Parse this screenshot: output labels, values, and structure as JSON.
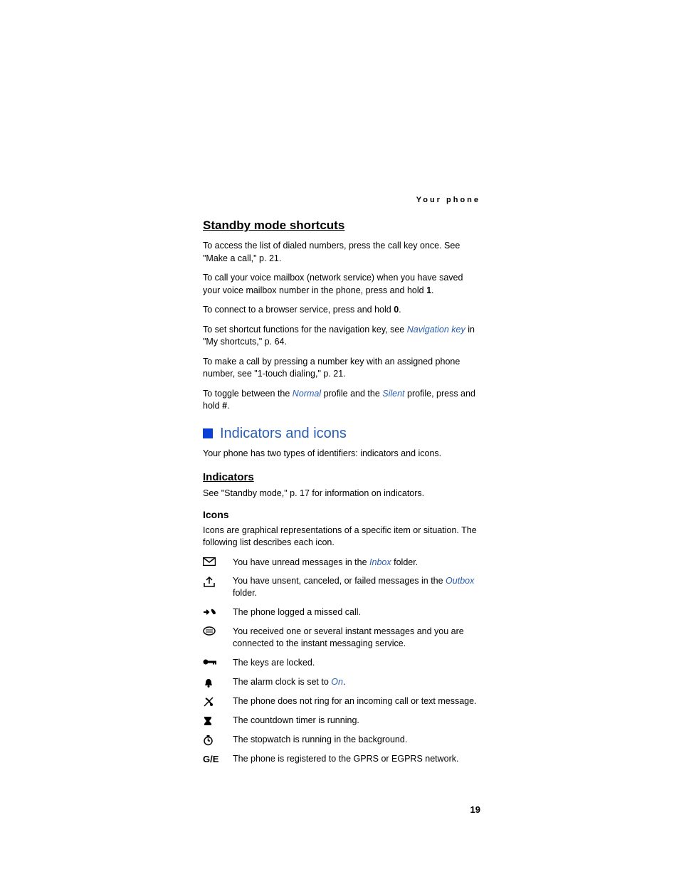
{
  "header": "Your phone",
  "heading1": "Standby mode shortcuts",
  "p1": "To access the list of dialed numbers, press the call key once. See \"Make a call,\" p. 21.",
  "p2a": "To call your voice mailbox (network service) when you have saved your voice mailbox number in the phone, press and hold ",
  "p2b": "1",
  "p2c": ".",
  "p3a": "To connect to a browser service, press and hold ",
  "p3b": "0",
  "p3c": ".",
  "p4a": "To set shortcut functions for the navigation key, see ",
  "p4link": "Navigation key",
  "p4b": " in \"My shortcuts,\" p. 64.",
  "p5": "To make a call by pressing a number key with an assigned phone number, see \"1-touch dialing,\" p. 21.",
  "p6a": "To toggle between the ",
  "p6link1": "Normal",
  "p6b": " profile and the ",
  "p6link2": "Silent",
  "p6c": " profile, press and hold ",
  "p6d": "#",
  "p6e": ".",
  "section_title": "Indicators and icons",
  "intro": "Your phone has two types of identifiers: indicators and icons.",
  "h_indicators": "Indicators",
  "p_indicators": "See \"Standby mode,\" p. 17 for information on indicators.",
  "h_icons": "Icons",
  "p_icons": "Icons are graphical representations of a specific item or situation. The following list describes each icon.",
  "icons": [
    {
      "desc_pre": "You have unread messages in the ",
      "link": "Inbox",
      "desc_post": " folder."
    },
    {
      "desc_pre": "You have unsent, canceled, or failed messages in the ",
      "link": "Outbox",
      "desc_post": " folder."
    },
    {
      "desc": "The phone logged a missed call."
    },
    {
      "desc": "You received one or several instant messages and you are connected to the instant messaging service."
    },
    {
      "desc": "The keys are locked."
    },
    {
      "desc_pre": "The alarm clock is set to ",
      "link": "On",
      "desc_post": "."
    },
    {
      "desc": "The phone does not ring for an incoming call or text message."
    },
    {
      "desc": "The countdown timer is running."
    },
    {
      "desc": "The stopwatch is running in the background."
    },
    {
      "desc": "The phone is registered to the GPRS or EGPRS network."
    }
  ],
  "ge_label": "G/E",
  "page_number": "19"
}
